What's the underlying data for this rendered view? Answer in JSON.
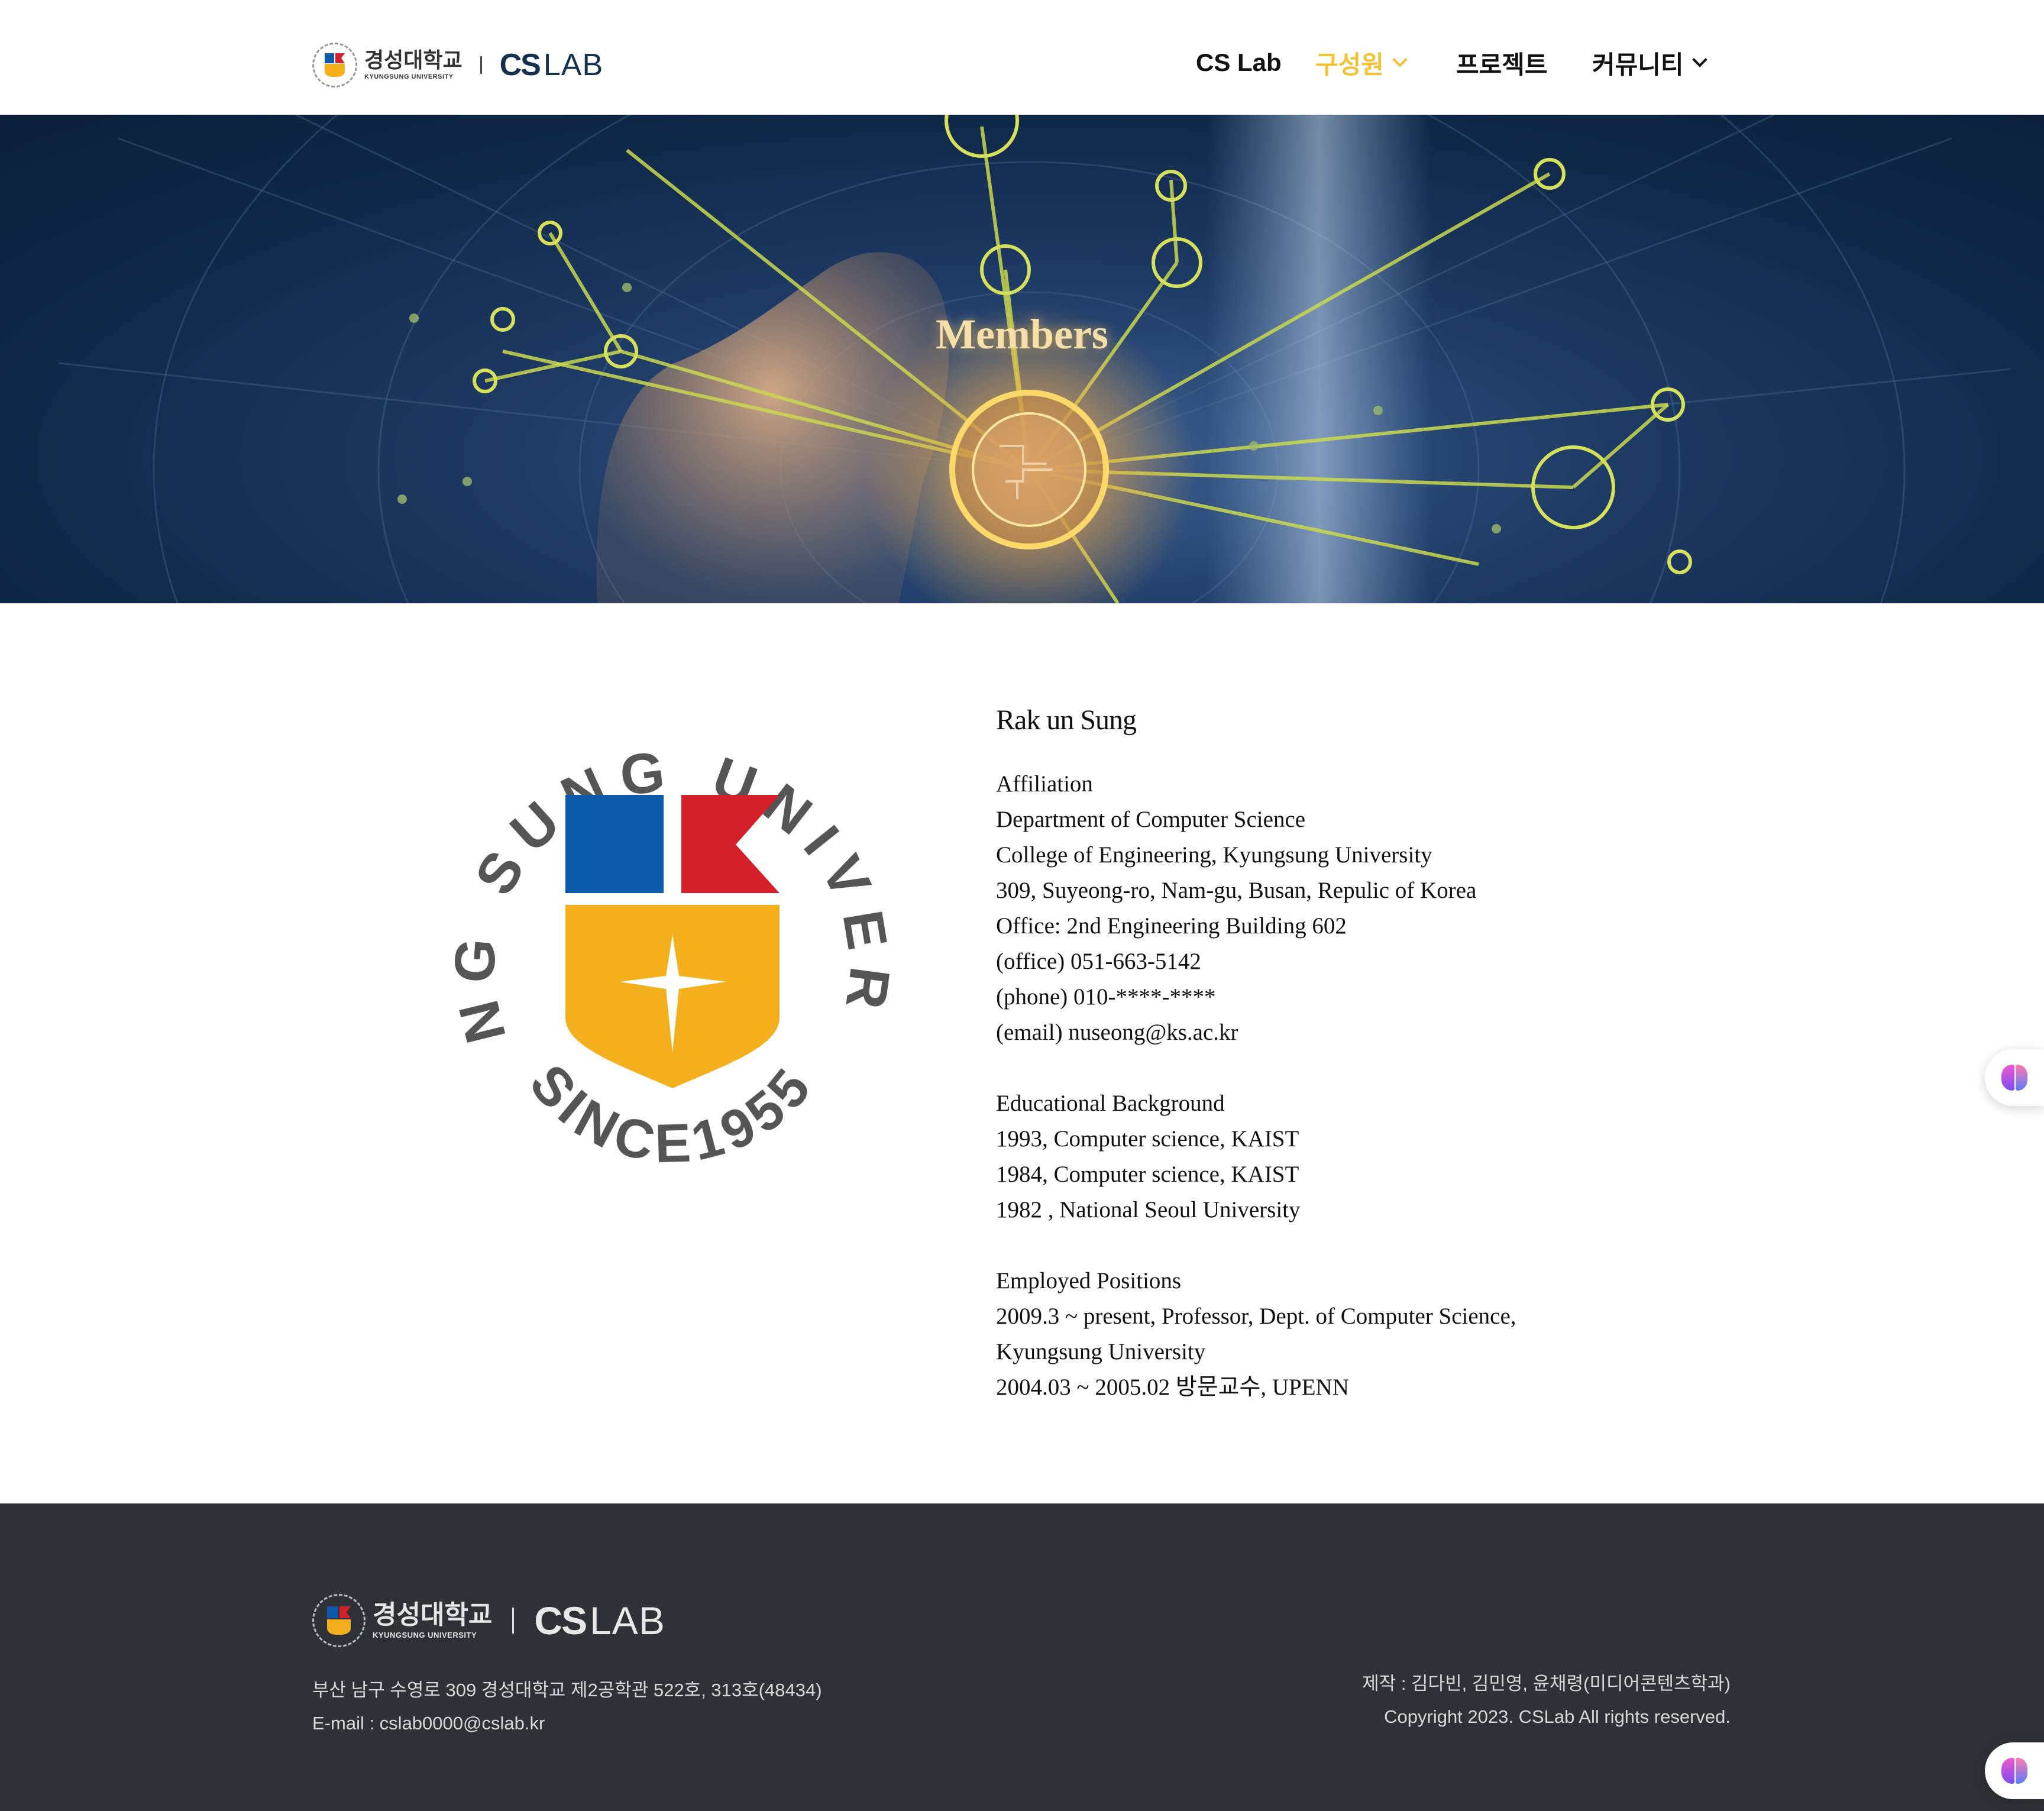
{
  "header": {
    "logo": {
      "univ_ko": "경성대학교",
      "univ_en": "KYUNGSUNG UNIVERSITY",
      "cs": "CS",
      "lab": "LAB"
    },
    "nav": [
      {
        "label": "CS Lab",
        "has_dropdown": false,
        "active": false
      },
      {
        "label": "구성원",
        "has_dropdown": true,
        "active": true
      },
      {
        "label": "프로젝트",
        "has_dropdown": false,
        "active": false
      },
      {
        "label": "커뮤니티",
        "has_dropdown": true,
        "active": false
      }
    ]
  },
  "hero": {
    "title": "Members"
  },
  "profile_image": {
    "arc_text": "KYUNG SUNG UNIVERSITY",
    "since_text": "SINCE1955",
    "colors": {
      "blue": "#0d59ac",
      "red": "#d3202a",
      "yellow": "#f3b01c",
      "text": "#555555"
    }
  },
  "member": {
    "name": "Rak un Sung",
    "affiliation": [
      "Affiliation",
      "Department of Computer Science",
      "College of Engineering, Kyungsung University",
      "309, Suyeong-ro, Nam-gu, Busan, Repulic of Korea",
      "Office: 2nd Engineering Building 602",
      "(office) 051-663-5142",
      "(phone) 010-****-****",
      "(email) nuseong@ks.ac.kr"
    ],
    "education": [
      "Educational Background",
      "1993, Computer science, KAIST",
      "1984, Computer science, KAIST",
      "1982 , National Seoul University"
    ],
    "positions": [
      "Employed Positions",
      "2009.3 ~ present, Professor, Dept. of Computer Science,",
      "Kyungsung University",
      "2004.03 ~ 2005.02 방문교수, UPENN"
    ]
  },
  "footer": {
    "address": "부산 남구 수영로 309 경성대학교 제2공학관 522호, 313호(48434)",
    "email": "E-mail : cslab0000@cslab.kr",
    "credits": "제작 : 김다빈, 김민영, 윤채령(미디어콘텐츠학과)",
    "copyright": "Copyright 2023. CSLab All rights reserved."
  },
  "widgets": {
    "icon": "brain-icon"
  },
  "colors": {
    "accent": "#f5c130",
    "footer_bg": "#2e3135",
    "hero_bg": "#102848"
  }
}
